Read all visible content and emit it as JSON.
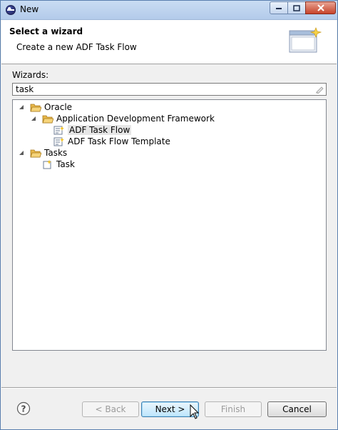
{
  "window": {
    "title": "New"
  },
  "header": {
    "title": "Select a wizard",
    "description": "Create a new ADF Task Flow"
  },
  "wizards": {
    "label": "Wizards:",
    "filter_value": "task",
    "tree": [
      {
        "label": "Oracle",
        "type": "folder"
      },
      {
        "label": "Application Development Framework",
        "type": "folder"
      },
      {
        "label": "ADF Task Flow",
        "type": "item",
        "selected": true
      },
      {
        "label": "ADF Task Flow Template",
        "type": "item"
      },
      {
        "label": "Tasks",
        "type": "folder"
      },
      {
        "label": "Task",
        "type": "item"
      }
    ]
  },
  "buttons": {
    "back": "< Back",
    "next": "Next >",
    "finish": "Finish",
    "cancel": "Cancel"
  },
  "colors": {
    "folder": "#e8b84a",
    "primary_button": "#bee6fd",
    "title_bar": "#c9dcf3"
  }
}
